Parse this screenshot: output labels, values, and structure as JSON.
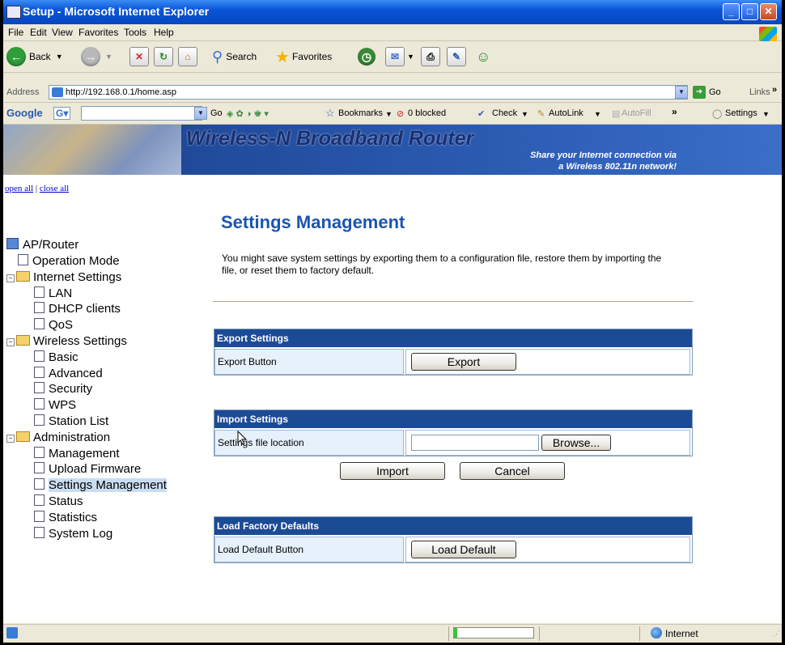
{
  "window": {
    "title": "Setup - Microsoft Internet Explorer"
  },
  "menu": [
    "File",
    "Edit",
    "View",
    "Favorites",
    "Tools",
    "Help"
  ],
  "toolbar": {
    "back": "Back",
    "search": "Search",
    "favorites": "Favorites"
  },
  "address": {
    "label": "Address",
    "url": "http://192.168.0.1/home.asp",
    "go": "Go",
    "links": "Links"
  },
  "googlebar": {
    "google": "Google",
    "go": "Go",
    "bookmarks": "Bookmarks",
    "blocked": "0 blocked",
    "check": "Check",
    "autolink": "AutoLink",
    "autofill": "AutoFill",
    "settings": "Settings"
  },
  "banner": {
    "title": "Wireless-N Broadband Router",
    "tagline1": "Share your Internet connection via",
    "tagline2": "a Wireless 802.11n network!"
  },
  "tree": {
    "open_all": "open all",
    "close_all": "close all",
    "root": "AP/Router",
    "operation_mode": "Operation Mode",
    "internet_settings": "Internet Settings",
    "lan": "LAN",
    "dhcp": "DHCP clients",
    "qos": "QoS",
    "wireless_settings": "Wireless Settings",
    "basic": "Basic",
    "advanced": "Advanced",
    "security": "Security",
    "wps": "WPS",
    "station_list": "Station List",
    "administration": "Administration",
    "management": "Management",
    "upload_firmware": "Upload Firmware",
    "settings_management": "Settings Management",
    "status": "Status",
    "statistics": "Statistics",
    "system_log": "System Log"
  },
  "main": {
    "title": "Settings Management",
    "description": "You might save system settings by exporting them to a configuration file, restore them by importing the file, or reset them to factory default.",
    "export": {
      "header": "Export Settings",
      "label": "Export Button",
      "button": "Export"
    },
    "import": {
      "header": "Import Settings",
      "label": "Settings file location",
      "browse": "Browse...",
      "import_button": "Import",
      "cancel_button": "Cancel"
    },
    "factory": {
      "header": "Load Factory Defaults",
      "label": "Load Default Button",
      "button": "Load Default"
    }
  },
  "status": {
    "zone": "Internet"
  }
}
